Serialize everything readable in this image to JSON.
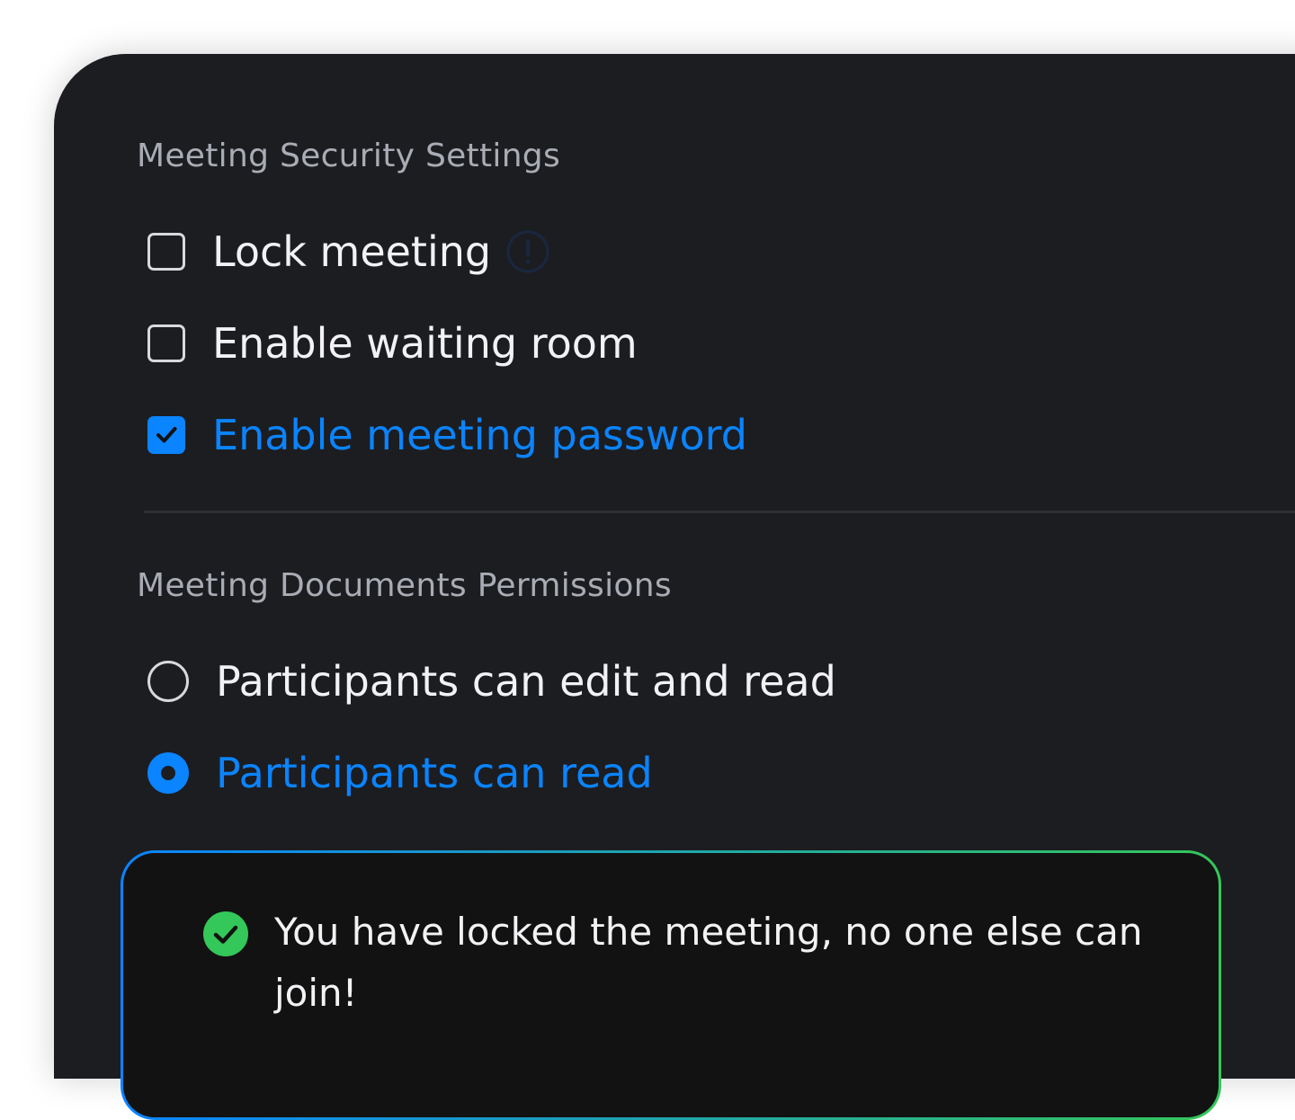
{
  "colors": {
    "accent": "#0a84ff",
    "success": "#34c759",
    "panel_bg": "#1c1d21",
    "text_primary": "#f2f2f4",
    "text_secondary": "#a9acb4"
  },
  "security": {
    "title": "Meeting Security Settings",
    "options": [
      {
        "label": "Lock meeting",
        "checked": false,
        "icon": "info-icon"
      },
      {
        "label": "Enable waiting room",
        "checked": false
      },
      {
        "label": "Enable meeting password",
        "checked": true
      }
    ]
  },
  "documents": {
    "title": "Meeting Documents Permissions",
    "options": [
      {
        "label": "Participants can edit and read",
        "selected": false
      },
      {
        "label": "Participants can read",
        "selected": true
      }
    ]
  },
  "notice": {
    "icon": "check-circle-icon",
    "text": "You have locked the meeting, no one else can join!"
  }
}
